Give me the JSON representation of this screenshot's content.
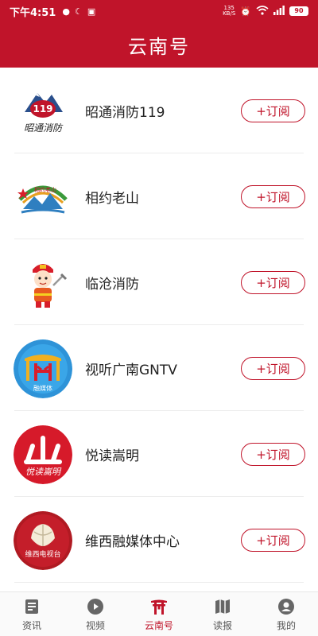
{
  "status": {
    "time": "下午4:51",
    "netspeed_value": "135",
    "netspeed_unit": "KB/S",
    "battery": "90"
  },
  "header": {
    "title": "云南号"
  },
  "subscribe_label": "+订阅",
  "accounts": [
    {
      "name": "昭通消防119",
      "logo_text": "119",
      "logo_caption": "昭通消防"
    },
    {
      "name": "相约老山",
      "logo_text": "相约老山"
    },
    {
      "name": "临沧消防"
    },
    {
      "name": "视听广南GNTV",
      "logo_text": "广南",
      "logo_caption": "融媒体"
    },
    {
      "name": "悦读嵩明",
      "logo_text": "山",
      "logo_caption": "悦读嵩明"
    },
    {
      "name": "维西融媒体中心",
      "logo_caption": "维西电视台"
    }
  ],
  "tabs": [
    {
      "label": "资讯",
      "icon": "news-icon"
    },
    {
      "label": "视频",
      "icon": "video-icon"
    },
    {
      "label": "云南号",
      "icon": "gate-icon",
      "active": true
    },
    {
      "label": "读报",
      "icon": "map-book-icon"
    },
    {
      "label": "我的",
      "icon": "user-icon"
    }
  ],
  "colors": {
    "brand": "#c0142a"
  }
}
